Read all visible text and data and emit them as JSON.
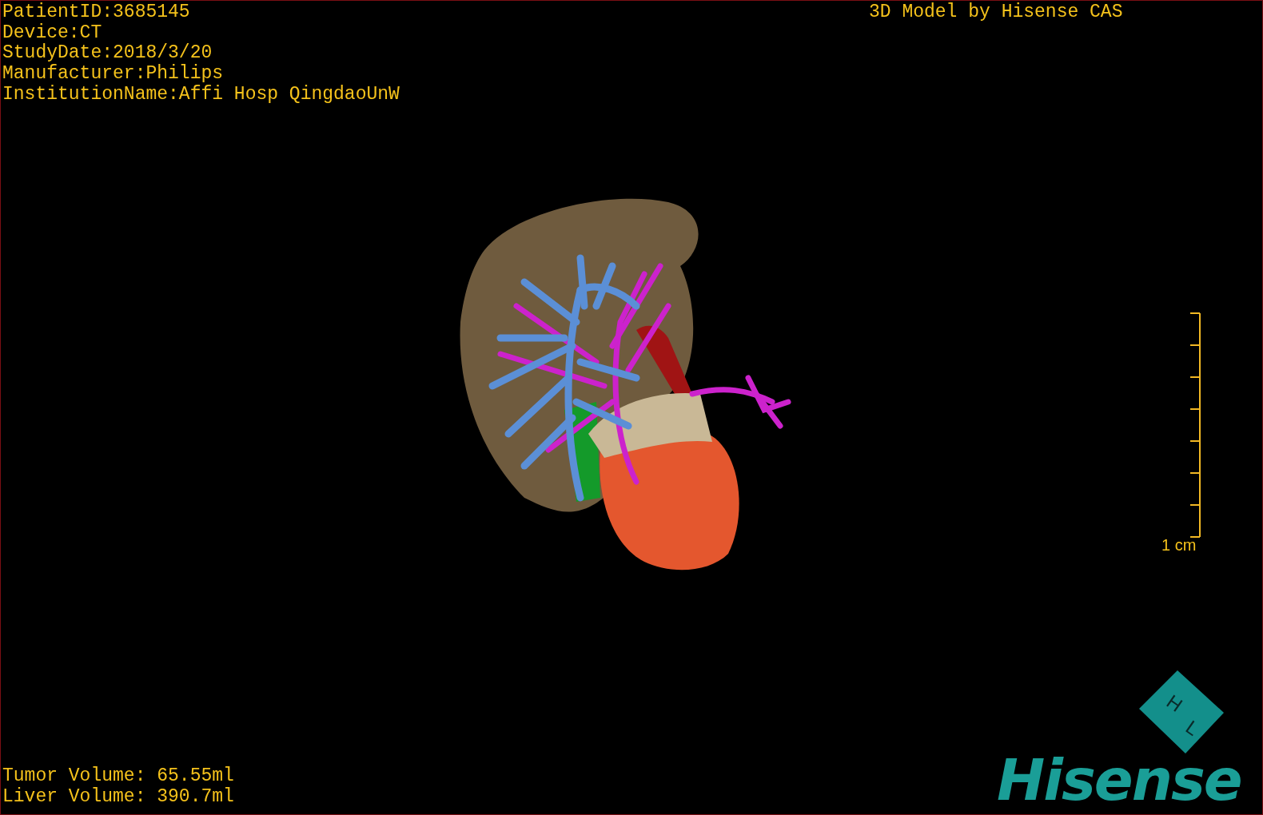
{
  "patient_info": [
    "PatientID:3685145",
    "Device:CT",
    "StudyDate:2018/3/20",
    "Manufacturer:Philips",
    "InstitutionName:Affi Hosp QingdaoUnW"
  ],
  "title": "3D Model by Hisense CAS",
  "scale_bar": {
    "label": "1 cm"
  },
  "volumes": [
    "Tumor Volume: 65.55ml",
    "Liver Volume: 390.7ml"
  ],
  "orientation_cube": {
    "labels": [
      "H",
      "L"
    ]
  },
  "logo": {
    "text": "Hisense"
  }
}
